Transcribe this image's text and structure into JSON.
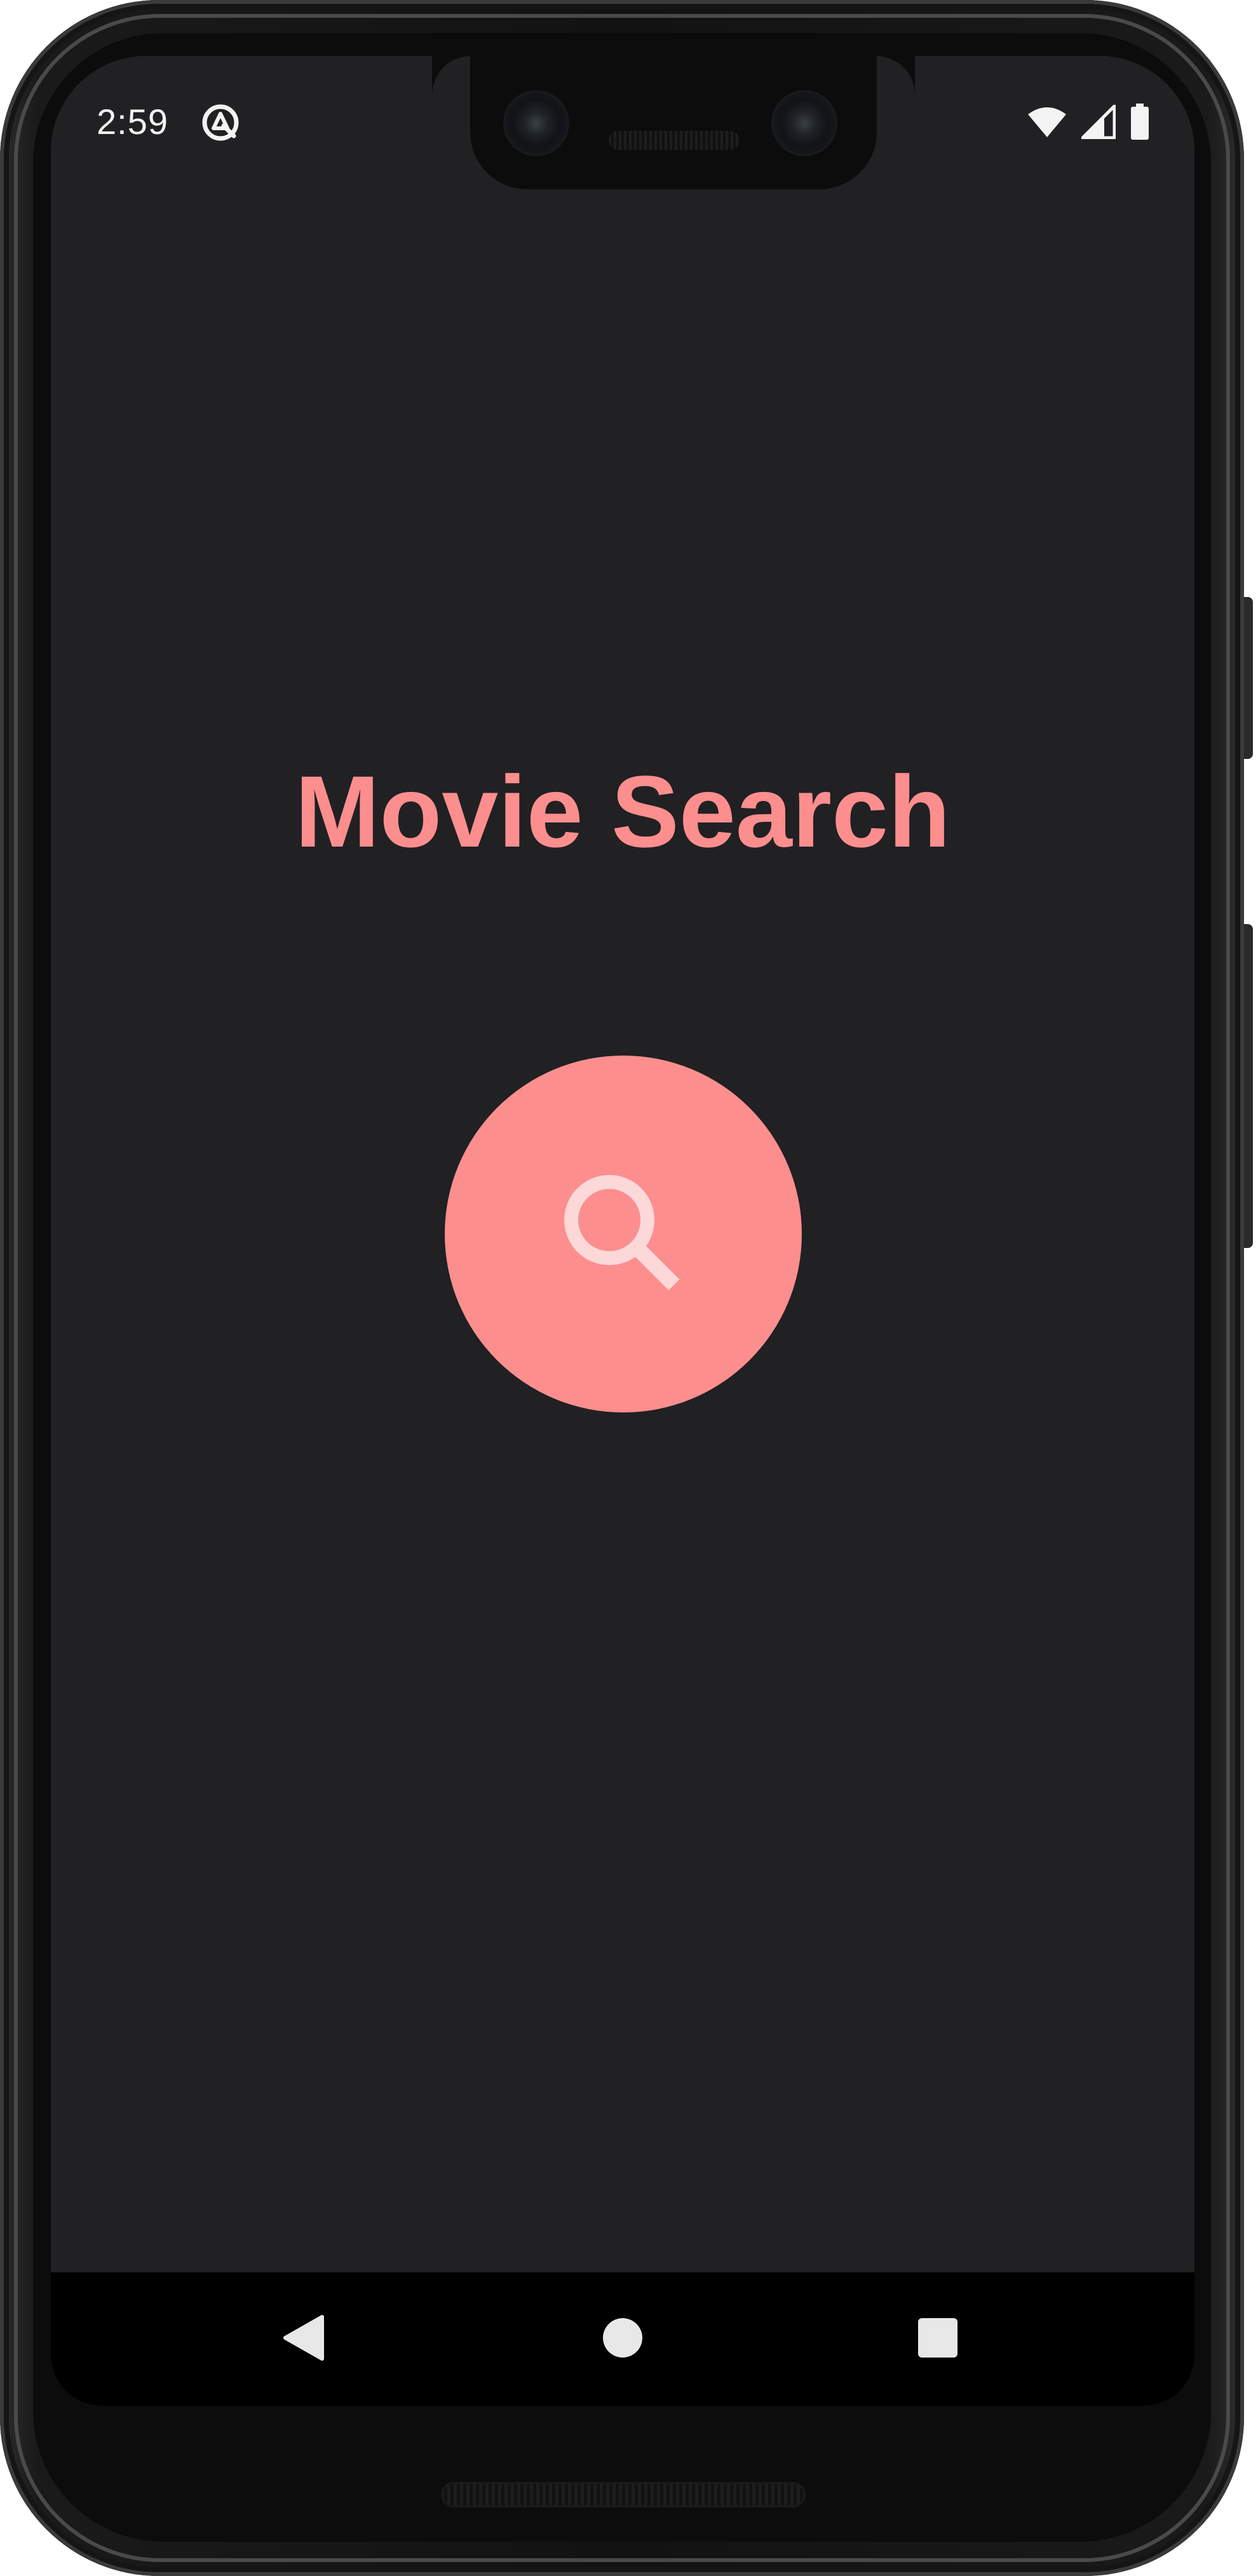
{
  "status_bar": {
    "time": "2:59",
    "notification_icon": "app-notification-icon",
    "icons": [
      "wifi-icon",
      "cellular-signal-icon",
      "battery-icon"
    ]
  },
  "main": {
    "title": "Movie Search",
    "search_button_icon": "search-icon"
  },
  "nav_bar": {
    "back_icon": "back-triangle-icon",
    "home_icon": "home-circle-icon",
    "recents_icon": "recents-square-icon"
  },
  "colors": {
    "background": "#212023",
    "accent": "#fc8e8e",
    "search_icon": "#fcd8d8",
    "nav_bar": "#000000",
    "status_text": "#f3f3f3"
  }
}
